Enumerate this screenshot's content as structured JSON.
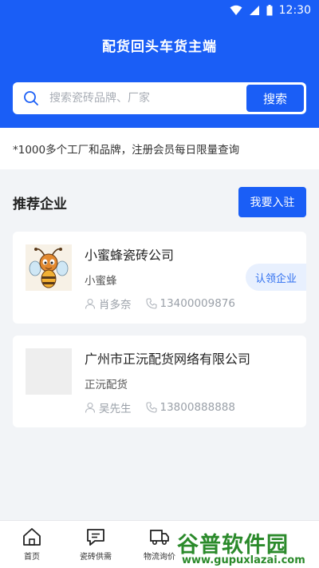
{
  "status_bar": {
    "time": "12:30"
  },
  "header": {
    "title": "配货回头车货主端"
  },
  "search": {
    "placeholder": "搜索瓷砖品牌、厂家",
    "button_label": "搜索"
  },
  "notice": {
    "text": "*1000多个工厂和品牌，注册会员每日限量查询"
  },
  "section": {
    "title": "推荐企业",
    "join_button": "我要入驻"
  },
  "companies": [
    {
      "name": "小蜜蜂瓷砖公司",
      "short_name": "小蜜蜂",
      "contact": "肖多奈",
      "phone": "13400009876",
      "tag": "认领企业",
      "logo": "bee-logo"
    },
    {
      "name": "广州市正沅配货网络有限公司",
      "short_name": "正沅配货",
      "contact": "吴先生",
      "phone": "13800888888",
      "logo": "placeholder"
    }
  ],
  "tabbar": {
    "items": [
      {
        "label": "首页",
        "icon": "home-icon"
      },
      {
        "label": "瓷砖供需",
        "icon": "chat-icon"
      },
      {
        "label": "物流询价",
        "icon": "truck-icon"
      },
      {
        "label": "",
        "icon": ""
      },
      {
        "label": "",
        "icon": ""
      }
    ]
  },
  "watermark": {
    "brand": "谷普软件园",
    "url": "www.gupuxlazai.com"
  },
  "colors": {
    "primary": "#1a5ef6",
    "tag_bg": "#e8f0fe",
    "watermark": "#2b8a2b"
  }
}
